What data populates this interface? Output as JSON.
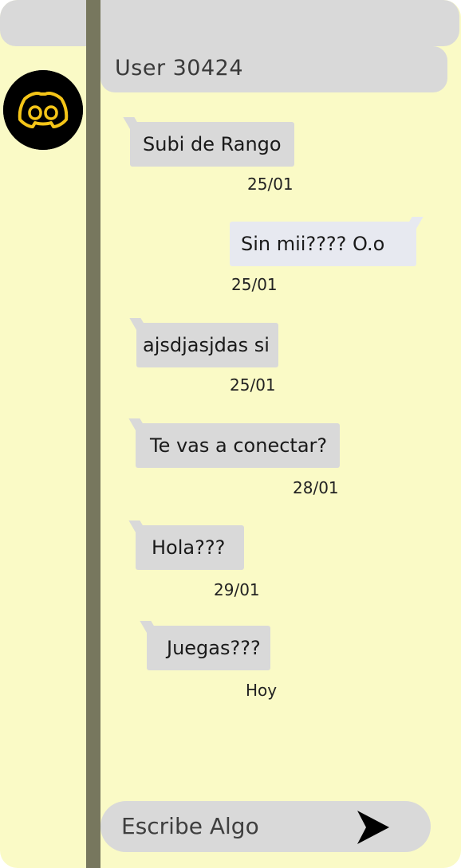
{
  "chat": {
    "user_name": "User 30424",
    "avatar_icon": "discord-logo-icon",
    "messages": [
      {
        "text": "Subi de Rango",
        "time": "25/01",
        "side": "left"
      },
      {
        "text": "Sin mii???? O.o",
        "time": "25/01",
        "side": "right"
      },
      {
        "text": "ajsdjasjdas si",
        "time": "25/01",
        "side": "left"
      },
      {
        "text": "Te vas a conectar?",
        "time": "28/01",
        "side": "left"
      },
      {
        "text": "Hola???",
        "time": "29/01",
        "side": "left"
      },
      {
        "text": "Juegas???",
        "time": "Hoy",
        "side": "left"
      }
    ]
  },
  "composer": {
    "placeholder": "Escribe Algo",
    "send_icon": "send-arrow-icon"
  },
  "colors": {
    "background": "#fafac6",
    "panel_gray": "#d9d9d9",
    "divider": "#77775e",
    "outgoing_bubble": "#e7e9f0",
    "avatar_accent": "#f5c518"
  }
}
